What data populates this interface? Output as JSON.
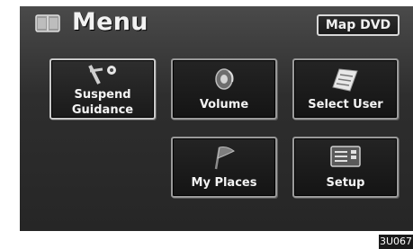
{
  "header": {
    "title": "Menu",
    "source_button": "Map DVD"
  },
  "tiles": {
    "suspend_line1": "Suspend",
    "suspend_line2": "Guidance",
    "volume": "Volume",
    "select_user": "Select User",
    "my_places": "My Places",
    "setup": "Setup"
  },
  "figure_code": "3U067",
  "icons": [
    "menu-icon",
    "suspend-guidance-icon",
    "volume-icon",
    "select-user-icon",
    "my-places-flag-icon",
    "setup-icon"
  ],
  "colors": {
    "screen_bg": "#2e2e2e",
    "text": "#f2f2f2",
    "tile_border": "#9a9a9a"
  }
}
